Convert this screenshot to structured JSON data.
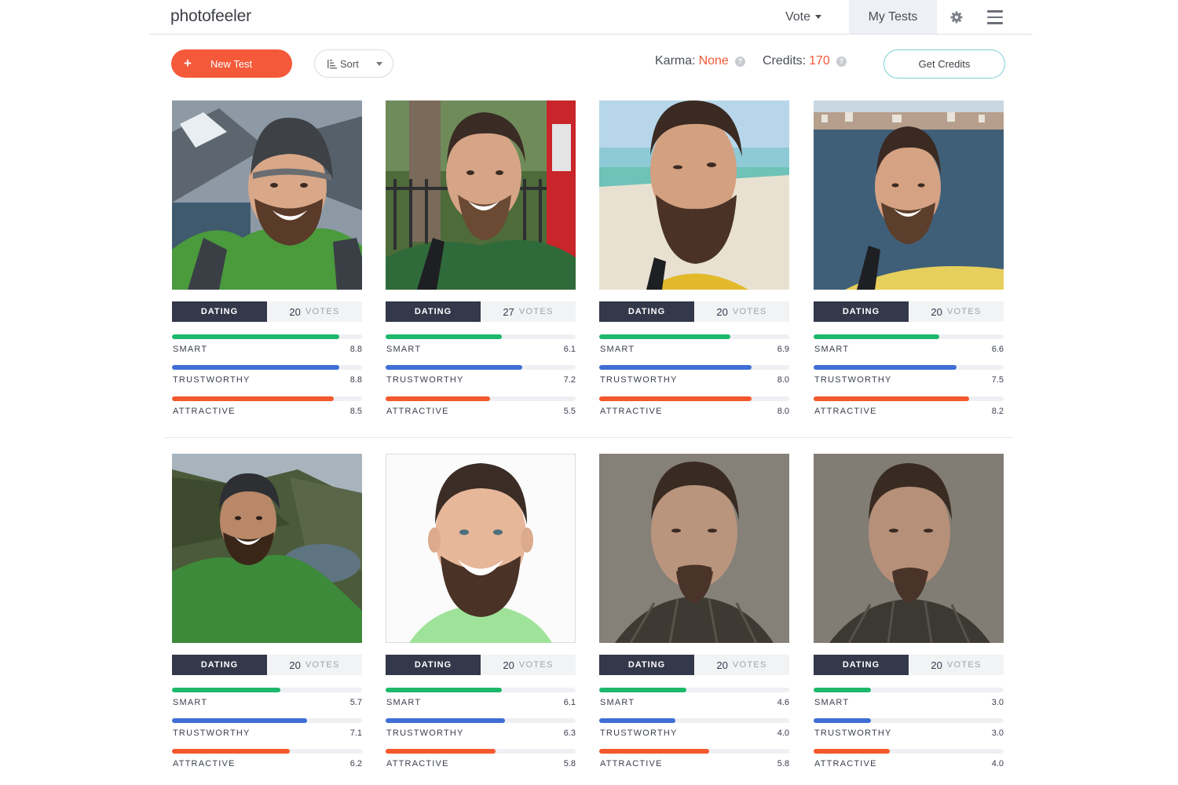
{
  "app": {
    "logo": "photofeeler",
    "nav": {
      "vote": "Vote",
      "my_tests": "My Tests"
    }
  },
  "toolbar": {
    "new_test": "New Test",
    "new_test_plus": "+",
    "sort": "Sort",
    "karma_label": "Karma:",
    "karma_value": "None",
    "credits_label": "Credits:",
    "credits_value": "170",
    "help_glyph": "?",
    "get_credits": "Get Credits"
  },
  "colors": {
    "accent_orange": "#f4593a",
    "tag_dark": "#33384a",
    "smart": "#1db86a",
    "trustworthy": "#3f6fd6",
    "attractive": "#f4582c"
  },
  "votes_word": "VOTES",
  "labels": {
    "smart": "SMART",
    "trustworthy": "TRUSTWORTHY",
    "attractive": "ATTRACTIVE"
  },
  "tests": [
    {
      "category": "DATING",
      "votes": "20",
      "smart": "8.8",
      "trustworthy": "8.8",
      "attractive": "8.5"
    },
    {
      "category": "DATING",
      "votes": "27",
      "smart": "6.1",
      "trustworthy": "7.2",
      "attractive": "5.5"
    },
    {
      "category": "DATING",
      "votes": "20",
      "smart": "6.9",
      "trustworthy": "8.0",
      "attractive": "8.0"
    },
    {
      "category": "DATING",
      "votes": "20",
      "smart": "6.6",
      "trustworthy": "7.5",
      "attractive": "8.2"
    },
    {
      "category": "DATING",
      "votes": "20",
      "smart": "5.7",
      "trustworthy": "7.1",
      "attractive": "6.2"
    },
    {
      "category": "DATING",
      "votes": "20",
      "smart": "6.1",
      "trustworthy": "6.3",
      "attractive": "5.8"
    },
    {
      "category": "DATING",
      "votes": "20",
      "smart": "4.6",
      "trustworthy": "4.0",
      "attractive": "5.8"
    },
    {
      "category": "DATING",
      "votes": "20",
      "smart": "3.0",
      "trustworthy": "3.0",
      "attractive": "4.0"
    }
  ]
}
